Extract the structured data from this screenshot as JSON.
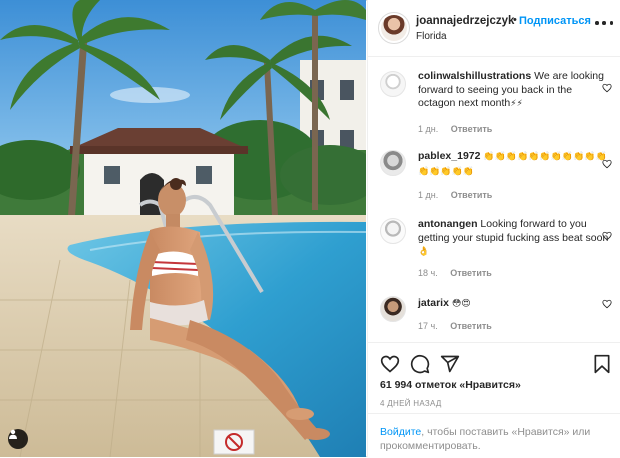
{
  "post": {
    "username": "joannajedrzejczyk",
    "separator": "•",
    "follow_label": "Подписаться",
    "location": "Florida",
    "photo_label": "pool photo"
  },
  "comments": [
    {
      "username": "colinwalshillustrations",
      "text": "We are looking forward to seeing you back in the octagon next month",
      "emoji": "⚡⚡",
      "time": "1 дн.",
      "reply_label": "Ответить"
    },
    {
      "username": "pablex_1972",
      "text": "",
      "emoji": "👏👏👏👏👏👏👏👏👏👏👏👏👏👏👏👏",
      "time": "1 дн.",
      "reply_label": "Ответить"
    },
    {
      "username": "antonangen",
      "text": "Looking forward to you getting your stupid fucking ass beat soon",
      "emoji": "👌",
      "time": "18 ч.",
      "reply_label": "Ответить"
    },
    {
      "username": "jatarix",
      "text": "",
      "emoji": "😳😍",
      "time": "17 ч.",
      "reply_label": "Ответить"
    }
  ],
  "actions": {
    "icons": [
      "heart-icon",
      "comment-icon",
      "share-icon",
      "bookmark-icon"
    ]
  },
  "likes": {
    "count_text": "61 994 отметок «Нравится»"
  },
  "date_text": "4 ДНЕЙ НАЗАД",
  "login_prompt": {
    "link": "Войдите",
    "rest": ", чтобы поставить «Нравится» или прокомментировать."
  },
  "colors": {
    "link_blue": "#0095f6",
    "text_dark": "#262626",
    "text_muted": "#8e8e8e",
    "border": "#efefef"
  }
}
